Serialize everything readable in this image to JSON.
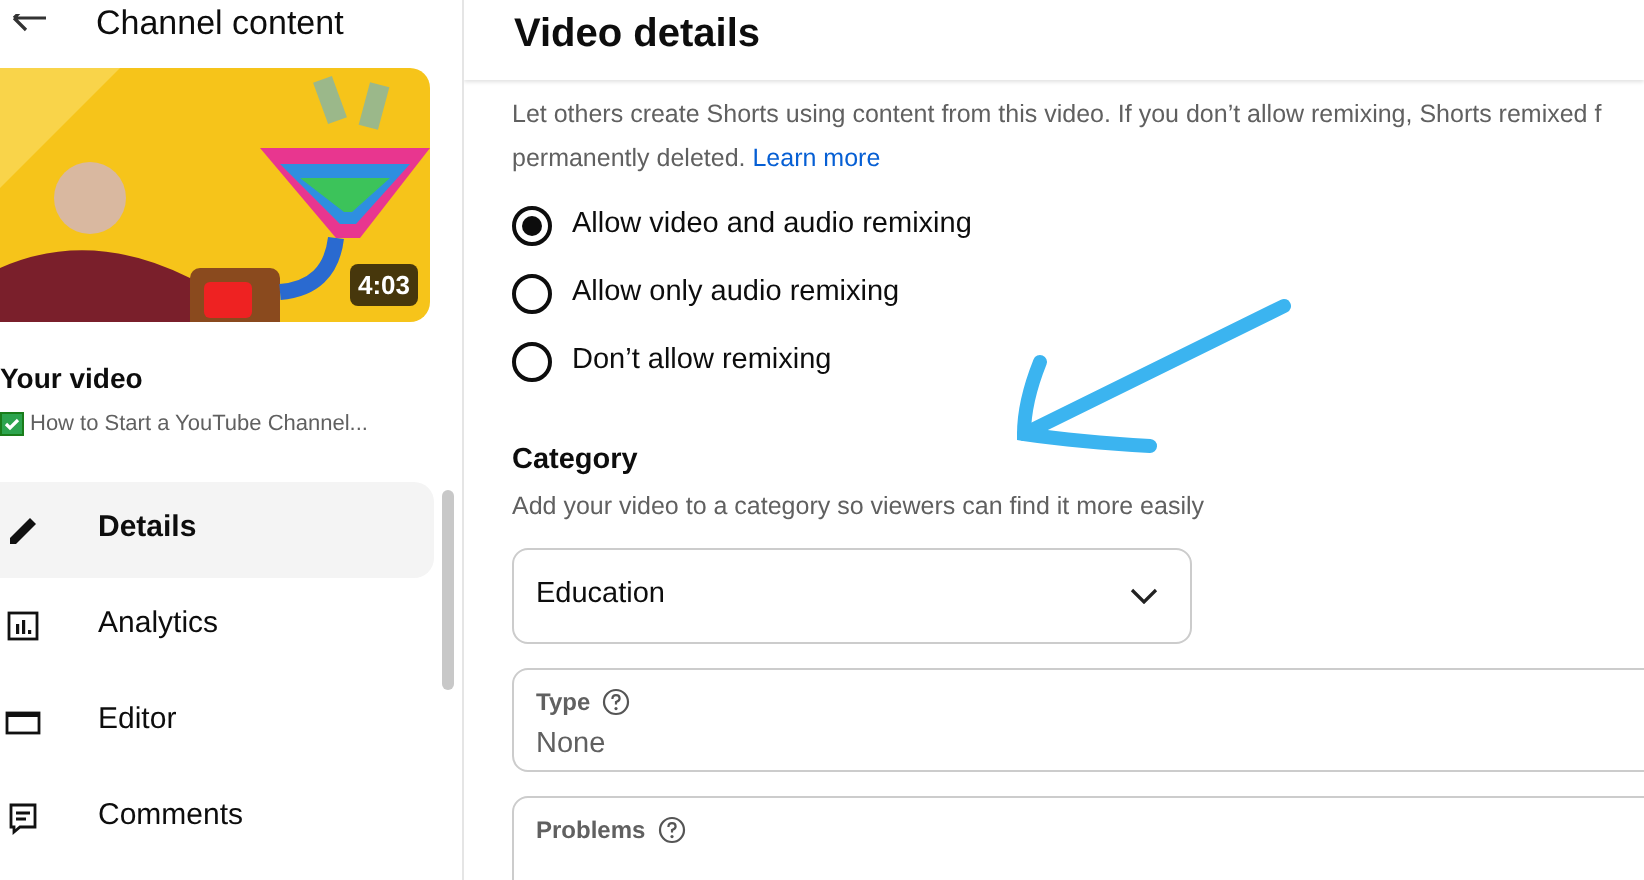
{
  "sidebar": {
    "header": "Channel content",
    "thumbnail": {
      "kind": "picture",
      "duration": "4:03"
    },
    "video_label": "Your video",
    "video_title": "How to Start a YouTube Channel...",
    "video_visibility_check": true,
    "items": [
      {
        "label": "Details",
        "selected": true
      },
      {
        "label": "Analytics",
        "selected": false
      },
      {
        "label": "Editor",
        "selected": false
      },
      {
        "label": "Comments",
        "selected": false
      }
    ]
  },
  "main": {
    "title": "Video details",
    "remix": {
      "description": "Let others create Shorts using content from this video. If you don’t allow remixing, Shorts remixed f",
      "description_2": "permanently deleted.",
      "link": "Learn more",
      "options": [
        {
          "label": "Allow video and audio remixing",
          "selected": true
        },
        {
          "label": "Allow only audio remixing",
          "selected": false
        },
        {
          "label": "Don’t allow remixing",
          "selected": false
        }
      ]
    },
    "category": {
      "title": "Category",
      "description": "Add your video to a category so viewers can find it more easily",
      "value": "Education"
    },
    "type": {
      "label": "Type",
      "value": "None"
    },
    "problems": {
      "label": "Problems"
    }
  }
}
